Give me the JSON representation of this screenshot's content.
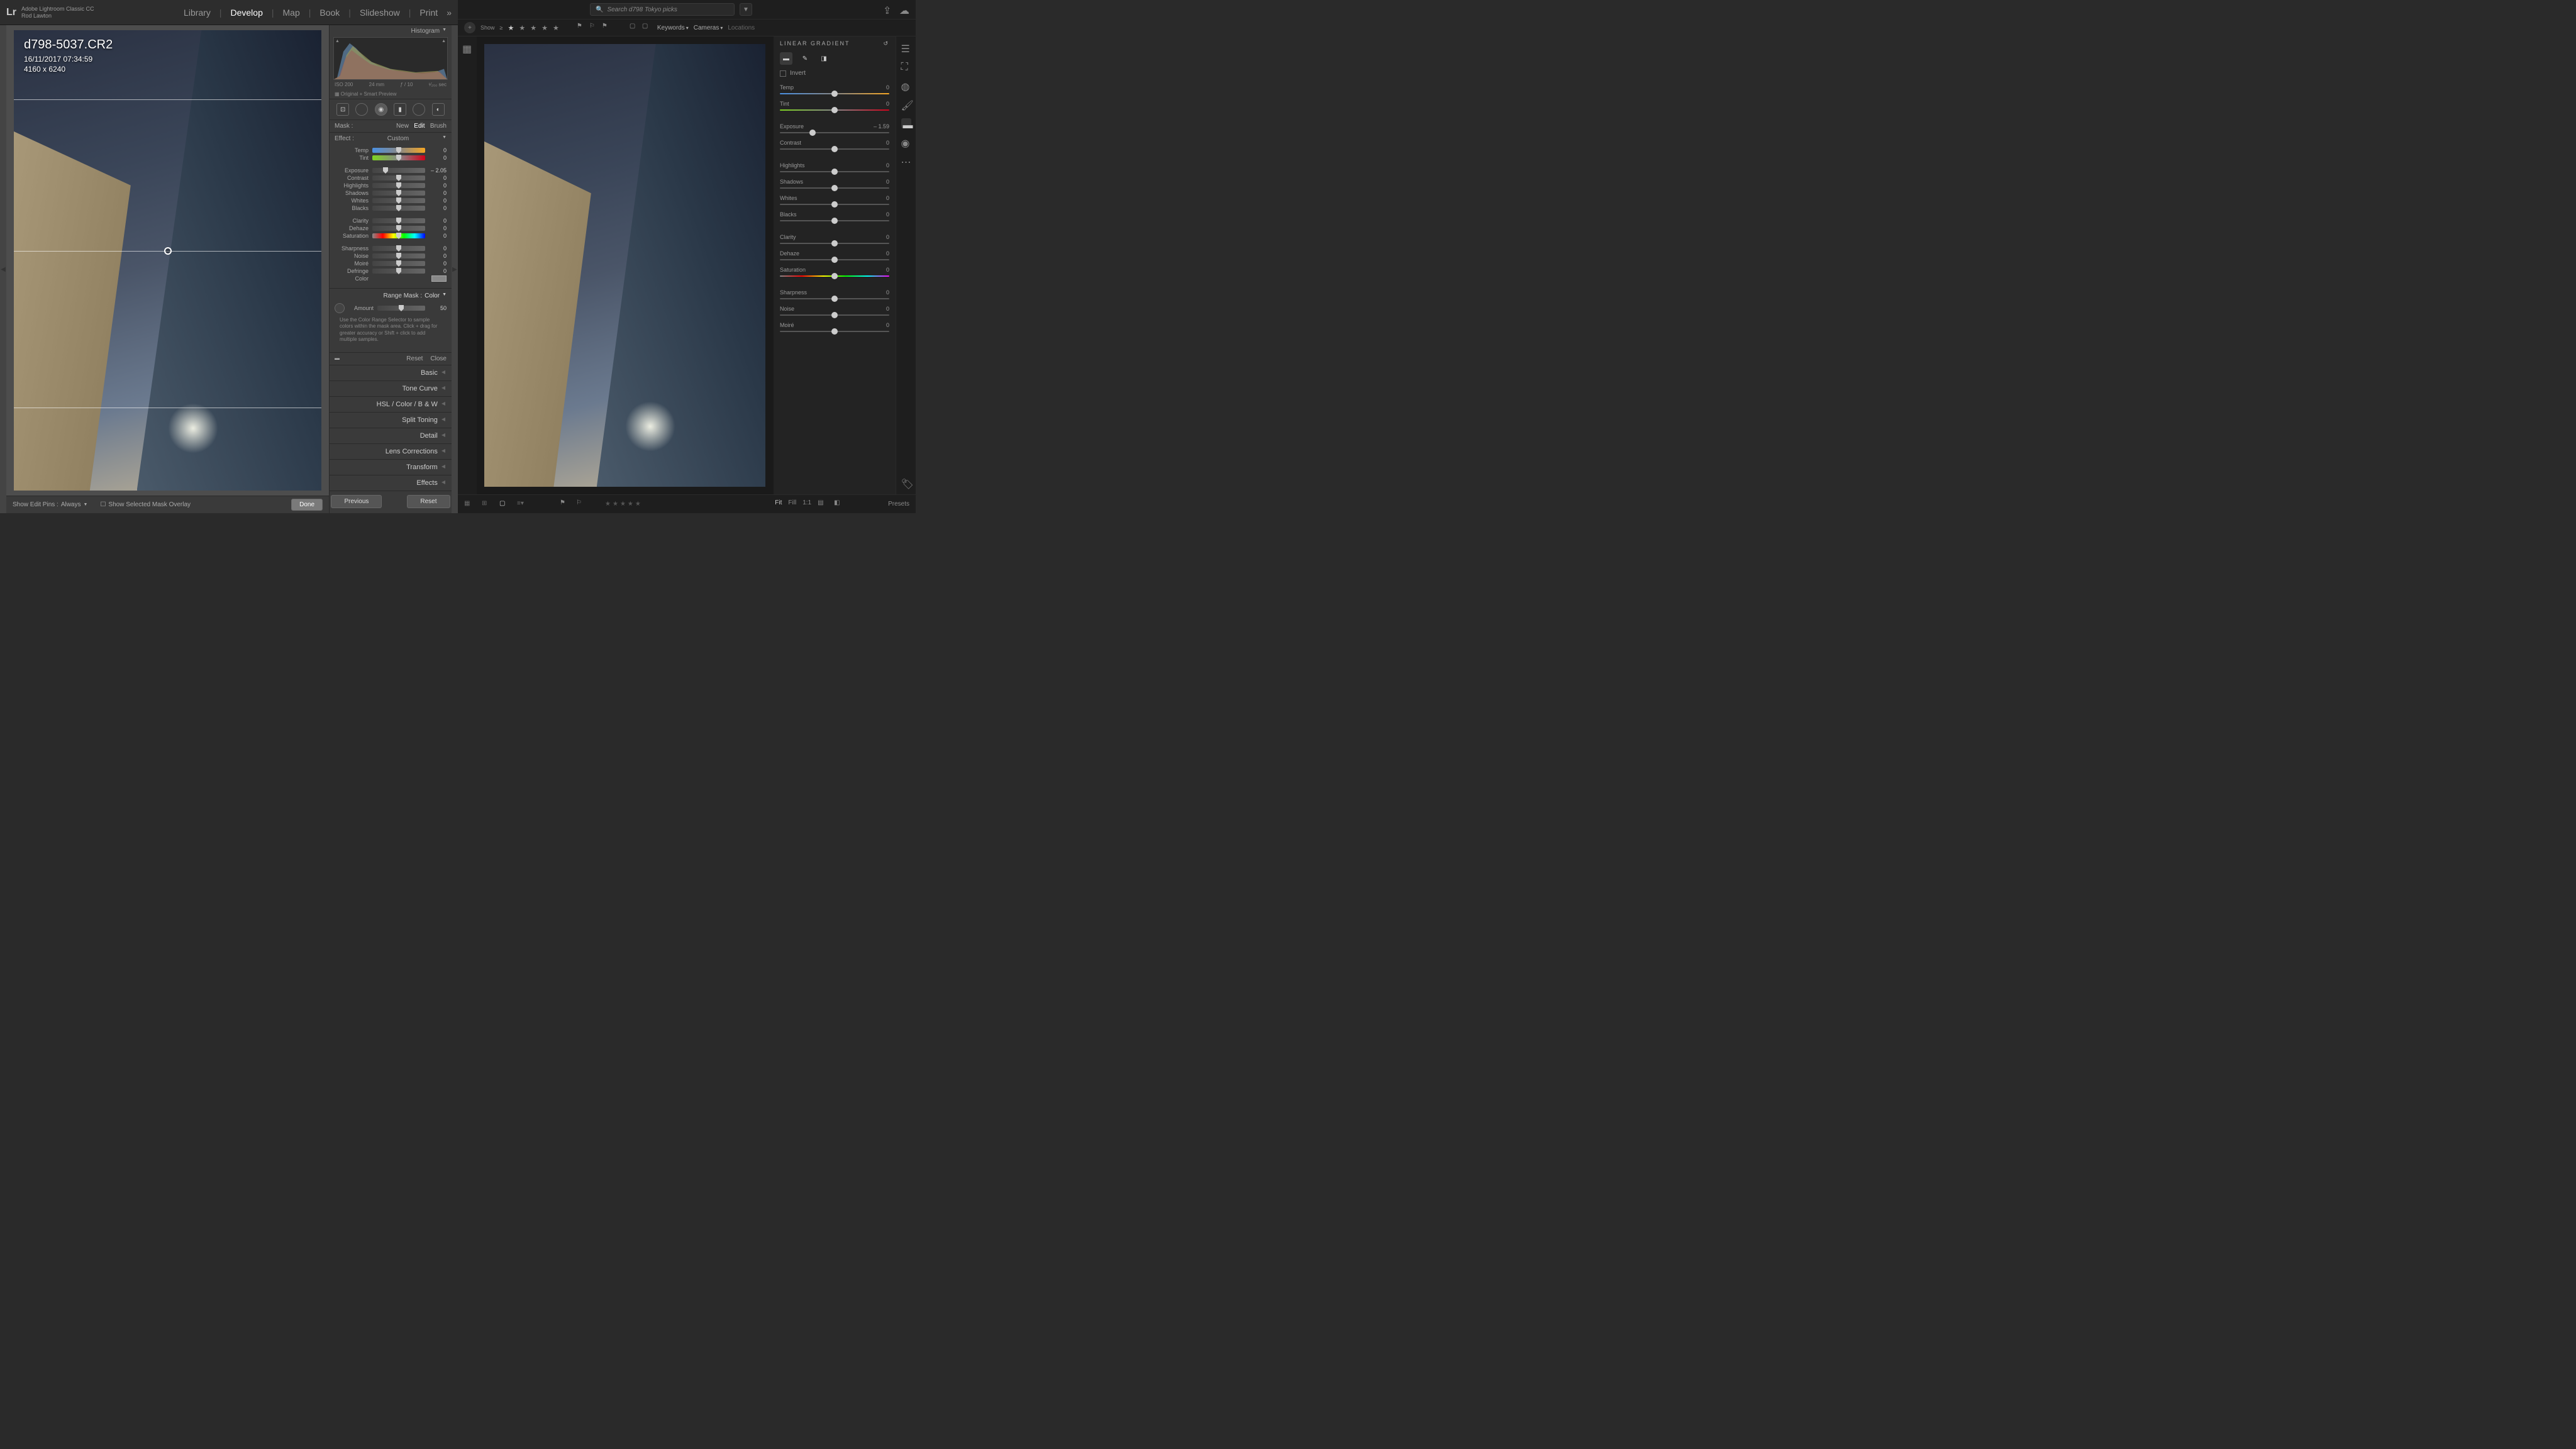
{
  "leftApp": {
    "appTitle": "Adobe Lightroom Classic CC",
    "userName": "Rod Lawton",
    "logo": "Lr",
    "modules": [
      "Library",
      "Develop",
      "Map",
      "Book",
      "Slideshow",
      "Print"
    ],
    "activeModule": "Develop",
    "image": {
      "filename": "d798-5037.CR2",
      "datetime": "16/11/2017 07:34:59",
      "dimensions": "4160 x 6240"
    },
    "histogram": {
      "label": "Histogram",
      "iso": "ISO 200",
      "focal": "24 mm",
      "aperture": "ƒ / 10",
      "shutter": "¹⁄₂₅₀ sec",
      "previewLabel": "Original + Smart Preview"
    },
    "mask": {
      "label": "Mask :",
      "new": "New",
      "edit": "Edit",
      "brush": "Brush"
    },
    "effect": {
      "label": "Effect :",
      "value": "Custom"
    },
    "sliders": {
      "temp": {
        "label": "Temp",
        "value": "0",
        "pos": 50
      },
      "tint": {
        "label": "Tint",
        "value": "0",
        "pos": 50
      },
      "exposure": {
        "label": "Exposure",
        "value": "– 2.05",
        "pos": 25
      },
      "contrast": {
        "label": "Contrast",
        "value": "0",
        "pos": 50
      },
      "highlights": {
        "label": "Highlights",
        "value": "0",
        "pos": 50
      },
      "shadows": {
        "label": "Shadows",
        "value": "0",
        "pos": 50
      },
      "whites": {
        "label": "Whites",
        "value": "0",
        "pos": 50
      },
      "blacks": {
        "label": "Blacks",
        "value": "0",
        "pos": 50
      },
      "clarity": {
        "label": "Clarity",
        "value": "0",
        "pos": 50
      },
      "dehaze": {
        "label": "Dehaze",
        "value": "0",
        "pos": 50
      },
      "saturation": {
        "label": "Saturation",
        "value": "0",
        "pos": 50
      },
      "sharpness": {
        "label": "Sharpness",
        "value": "0",
        "pos": 50
      },
      "noise": {
        "label": "Noise",
        "value": "0",
        "pos": 50
      },
      "moire": {
        "label": "Moiré",
        "value": "0",
        "pos": 50
      },
      "defringe": {
        "label": "Defringe",
        "value": "0",
        "pos": 50
      },
      "color": {
        "label": "Color"
      }
    },
    "rangeMask": {
      "label": "Range Mask :",
      "value": "Color",
      "amountLabel": "Amount",
      "amountValue": "50"
    },
    "hint": "Use the Color Range Selector to sample colors within the mask area. Click + drag for greater accuracy or Shift + click to add multiple samples.",
    "resetClose": {
      "reset": "Reset",
      "close": "Close"
    },
    "sections": [
      "Basic",
      "Tone Curve",
      "Split Toning",
      "Detail",
      "Lens Corrections",
      "Transform",
      "Effects"
    ],
    "hslRow": {
      "hsl": "HSL",
      "color": "Color",
      "bw": "B & W"
    },
    "toolbar": {
      "showEditPins": "Show Edit Pins :",
      "always": "Always",
      "showOverlay": "Show Selected Mask Overlay",
      "done": "Done"
    },
    "bottomNav": {
      "previous": "Previous",
      "reset": "Reset"
    }
  },
  "rightApp": {
    "search": {
      "placeholder": "Search d798 Tokyo picks"
    },
    "filterbar": {
      "show": "Show",
      "showN": "≥",
      "keywords": "Keywords",
      "cameras": "Cameras",
      "locations": "Locations"
    },
    "panel": {
      "title": "LINEAR GRADIENT",
      "invert": "Invert",
      "sliders": {
        "temp": {
          "label": "Temp",
          "value": "0",
          "pos": 50
        },
        "tint": {
          "label": "Tint",
          "value": "0",
          "pos": 50
        },
        "exposure": {
          "label": "Exposure",
          "value": "– 1.59",
          "pos": 30
        },
        "contrast": {
          "label": "Contrast",
          "value": "0",
          "pos": 50
        },
        "highlights": {
          "label": "Highlights",
          "value": "0",
          "pos": 50
        },
        "shadows": {
          "label": "Shadows",
          "value": "0",
          "pos": 50
        },
        "whites": {
          "label": "Whites",
          "value": "0",
          "pos": 50
        },
        "blacks": {
          "label": "Blacks",
          "value": "0",
          "pos": 50
        },
        "clarity": {
          "label": "Clarity",
          "value": "0",
          "pos": 50
        },
        "dehaze": {
          "label": "Dehaze",
          "value": "0",
          "pos": 50
        },
        "saturation": {
          "label": "Saturation",
          "value": "0",
          "pos": 50
        },
        "sharpness": {
          "label": "Sharpness",
          "value": "0",
          "pos": 50
        },
        "noise": {
          "label": "Noise",
          "value": "0",
          "pos": 50
        },
        "moire": {
          "label": "Moiré",
          "value": "0",
          "pos": 50
        }
      }
    },
    "footer": {
      "fit": "Fit",
      "fill": "Fill",
      "oneToOne": "1:1",
      "presets": "Presets"
    }
  }
}
